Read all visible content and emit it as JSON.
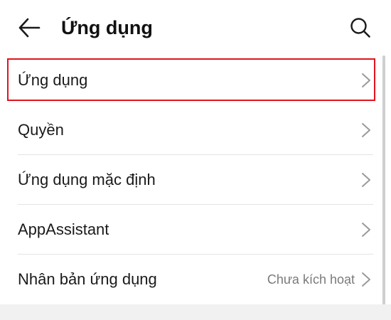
{
  "header": {
    "back_icon": "arrow-left-icon",
    "title": "Ứng dụng",
    "search_icon": "search-icon"
  },
  "menu": [
    {
      "label": "Ứng dụng",
      "value": ""
    },
    {
      "label": "Quyền",
      "value": ""
    },
    {
      "label": "Ứng dụng mặc định",
      "value": ""
    },
    {
      "label": "AppAssistant",
      "value": ""
    },
    {
      "label": "Nhân bản ứng dụng",
      "value": "Chưa kích hoạt"
    }
  ],
  "colors": {
    "highlight": "#e0141e",
    "text": "#1a1a1a",
    "secondary_text": "#7a7a7a",
    "chevron": "#9a9a9a",
    "divider": "#e4e4e4"
  }
}
